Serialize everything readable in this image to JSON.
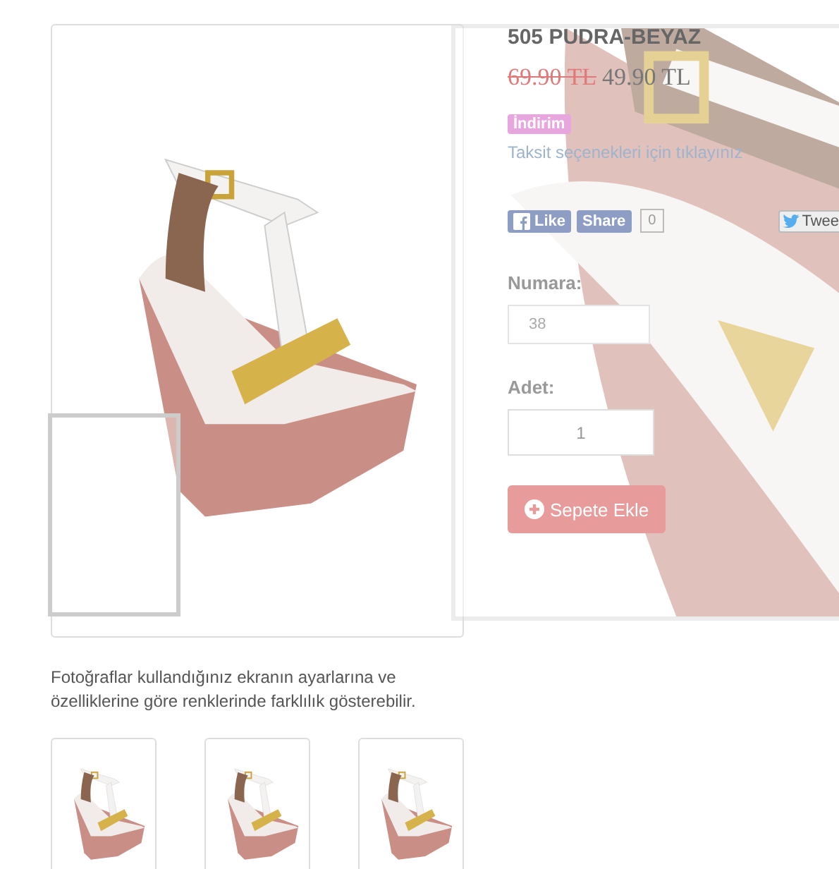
{
  "product": {
    "title": "505 PUDRA-BEYAZ",
    "old_price": "69.90 TL",
    "price": "49.90 TL",
    "badge": "İndirim",
    "installment_link": "Taksit seçenekleri için tıklayınız"
  },
  "social": {
    "like": "Like",
    "share": "Share",
    "share_count": "0",
    "tweet": "Twee"
  },
  "size": {
    "label": "Numara:",
    "value": "38"
  },
  "quantity": {
    "label": "Adet:",
    "value": "1"
  },
  "add_to_cart": "Sepete Ekle",
  "photo_note": "Fotoğraflar kullandığınız ekranın ayarlarına ve özelliklerine göre renklerinde farklılık gösterebilir."
}
